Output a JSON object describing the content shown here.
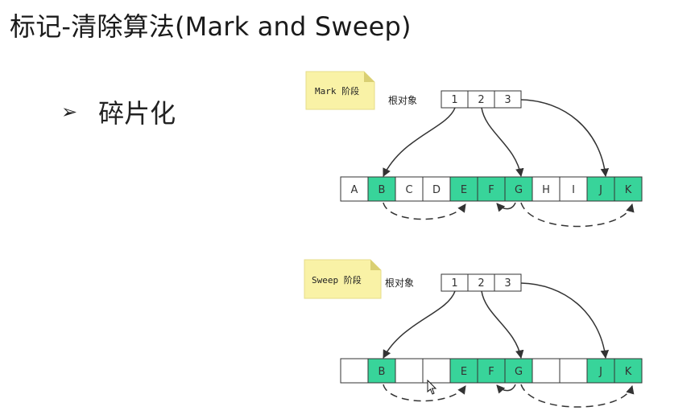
{
  "slide": {
    "title": "标记-清除算法(Mark and Sweep)",
    "bullet_marker": "➢",
    "bullet_text": "碎片化"
  },
  "colors": {
    "marked": "#38d49a",
    "unmarked": "#ffffff",
    "note": "#f9f2a6",
    "note_fold": "#d9cf72",
    "stroke": "#333333"
  },
  "mark_phase": {
    "note": "Mark 阶段",
    "root_label": "根对象",
    "roots": [
      "1",
      "2",
      "3"
    ],
    "heap": [
      {
        "label": "A",
        "marked": false
      },
      {
        "label": "B",
        "marked": true
      },
      {
        "label": "C",
        "marked": false
      },
      {
        "label": "D",
        "marked": false
      },
      {
        "label": "E",
        "marked": true
      },
      {
        "label": "F",
        "marked": true
      },
      {
        "label": "G",
        "marked": true
      },
      {
        "label": "H",
        "marked": false
      },
      {
        "label": "I",
        "marked": false
      },
      {
        "label": "J",
        "marked": true
      },
      {
        "label": "K",
        "marked": true
      }
    ]
  },
  "sweep_phase": {
    "note": "Sweep 阶段",
    "root_label": "根对象",
    "roots": [
      "1",
      "2",
      "3"
    ],
    "heap": [
      {
        "label": "",
        "marked": false
      },
      {
        "label": "B",
        "marked": true
      },
      {
        "label": "",
        "marked": false
      },
      {
        "label": "",
        "marked": false
      },
      {
        "label": "E",
        "marked": true
      },
      {
        "label": "F",
        "marked": true
      },
      {
        "label": "G",
        "marked": true
      },
      {
        "label": "",
        "marked": false
      },
      {
        "label": "",
        "marked": false
      },
      {
        "label": "J",
        "marked": true
      },
      {
        "label": "K",
        "marked": true
      }
    ]
  }
}
